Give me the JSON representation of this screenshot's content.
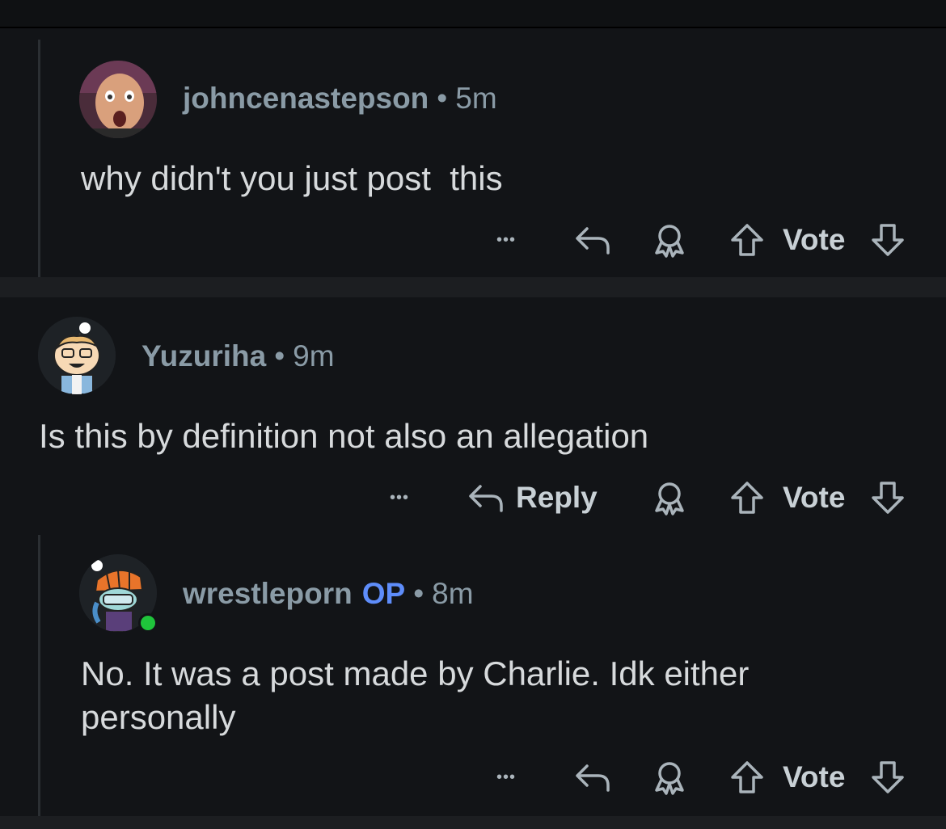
{
  "comments": [
    {
      "username": "johncenastepson",
      "dot": "•",
      "time": "5m",
      "body": "why didn't you just post  this",
      "actions": {
        "more": "•••",
        "vote": "Vote"
      }
    },
    {
      "username": "Yuzuriha",
      "dot": "•",
      "time": "9m",
      "body": "Is this by definition not also an allegation",
      "actions": {
        "more": "•••",
        "reply": "Reply",
        "vote": "Vote"
      }
    },
    {
      "username": "wrestleporn",
      "op_badge": "OP",
      "dot": "•",
      "time": "8m",
      "body": "No. It was a post made by Charlie. Idk either personally",
      "actions": {
        "more": "•••",
        "vote": "Vote"
      },
      "online": true
    }
  ],
  "colors": {
    "background": "#0f1113",
    "username": "#8a9ba6",
    "op_badge": "#5e8dfa",
    "online_indicator": "#1fc43b"
  }
}
